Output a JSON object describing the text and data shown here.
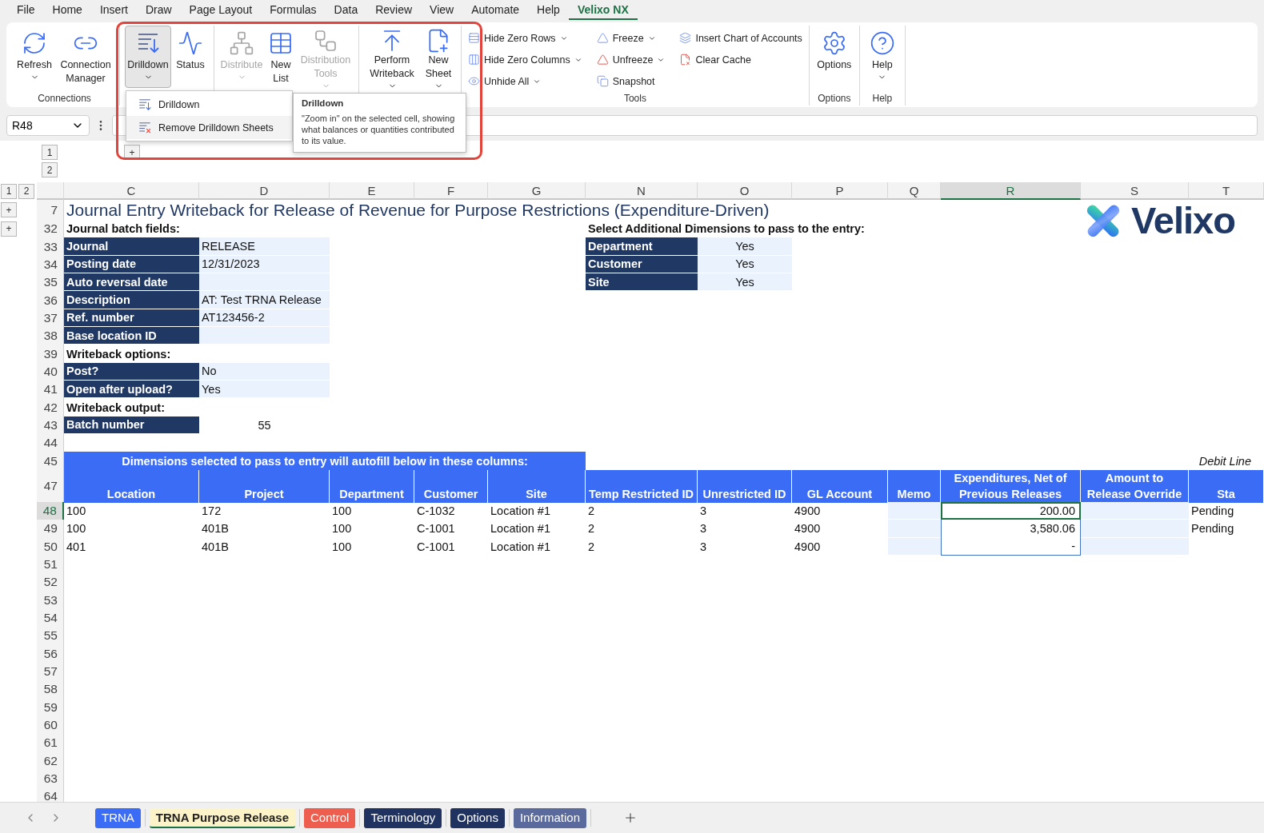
{
  "menu_tabs": [
    {
      "label": "File",
      "selected": false
    },
    {
      "label": "Home",
      "selected": false
    },
    {
      "label": "Insert",
      "selected": false
    },
    {
      "label": "Draw",
      "selected": false
    },
    {
      "label": "Page Layout",
      "selected": false
    },
    {
      "label": "Formulas",
      "selected": false
    },
    {
      "label": "Data",
      "selected": false
    },
    {
      "label": "Review",
      "selected": false
    },
    {
      "label": "View",
      "selected": false
    },
    {
      "label": "Automate",
      "selected": false
    },
    {
      "label": "Help",
      "selected": false
    },
    {
      "label": "Velixo NX",
      "selected": true
    }
  ],
  "ribbon": {
    "connections": {
      "label": "Connections",
      "buttons": [
        {
          "label": "Refresh",
          "caret": true,
          "disabled": false,
          "pressed": false
        },
        {
          "label": "Connection Manager",
          "caret": false,
          "disabled": false,
          "pressed": false
        }
      ]
    },
    "main": {
      "buttons": [
        {
          "label": "Drilldown",
          "caret": true,
          "disabled": false,
          "pressed": true
        },
        {
          "label": "Status",
          "caret": false,
          "disabled": false,
          "pressed": false
        },
        {
          "label": "Distribute",
          "caret": true,
          "disabled": true,
          "pressed": false
        },
        {
          "label": "New List",
          "caret": false,
          "disabled": false,
          "pressed": false
        },
        {
          "label": "Distribution Tools",
          "caret": true,
          "disabled": true,
          "pressed": false
        },
        {
          "label": "Perform Writeback",
          "caret": true,
          "disabled": false,
          "pressed": false
        },
        {
          "label": "New Sheet",
          "caret": true,
          "disabled": false,
          "pressed": false
        }
      ]
    },
    "tools": {
      "label": "Tools",
      "buttons": [
        {
          "label": "Hide Zero Rows",
          "caret": true
        },
        {
          "label": "Hide Zero Columns",
          "caret": true
        },
        {
          "label": "Unhide All",
          "caret": true
        },
        {
          "label": "Freeze",
          "caret": true
        },
        {
          "label": "Unfreeze",
          "caret": true
        },
        {
          "label": "Snapshot",
          "caret": false
        },
        {
          "label": "Insert Chart of Accounts",
          "caret": false
        },
        {
          "label": "Clear Cache",
          "caret": false
        }
      ]
    },
    "options": {
      "label": "Options",
      "buttons": [
        {
          "label": "Options",
          "caret": false,
          "disabled": false,
          "pressed": false
        }
      ]
    },
    "help": {
      "label": "Help",
      "buttons": [
        {
          "label": "Help",
          "caret": true,
          "disabled": false,
          "pressed": false
        }
      ]
    }
  },
  "dropdown_menu": {
    "items": [
      {
        "label": "Drilldown",
        "selected": false
      },
      {
        "label": "Remove Drilldown Sheets",
        "selected": true
      }
    ]
  },
  "tooltip": {
    "title": "Drilldown",
    "text": "\"Zoom in\" on the selected cell, showing what balances or quantities contributed to its value."
  },
  "name_box": "R48",
  "outline": {
    "column_levels": [
      "1",
      "2"
    ],
    "column_expand": "+",
    "row_levels": [
      "1",
      "2"
    ]
  },
  "columns": [
    {
      "letter": "C",
      "selected": false
    },
    {
      "letter": "D",
      "selected": false
    },
    {
      "letter": "E",
      "selected": false
    },
    {
      "letter": "F",
      "selected": false
    },
    {
      "letter": "G",
      "selected": false
    },
    {
      "letter": "N",
      "selected": false
    },
    {
      "letter": "O",
      "selected": false
    },
    {
      "letter": "P",
      "selected": false
    },
    {
      "letter": "Q",
      "selected": false
    },
    {
      "letter": "R",
      "selected": true
    },
    {
      "letter": "S",
      "selected": false
    },
    {
      "letter": "T",
      "selected": false
    }
  ],
  "row_headers": [
    {
      "number": "7",
      "selected": false,
      "expand": "+"
    },
    {
      "number": "32",
      "selected": false,
      "expand": "+"
    },
    {
      "number": "33",
      "selected": false
    },
    {
      "number": "34",
      "selected": false
    },
    {
      "number": "35",
      "selected": false
    },
    {
      "number": "36",
      "selected": false
    },
    {
      "number": "37",
      "selected": false
    },
    {
      "number": "38",
      "selected": false
    },
    {
      "number": "39",
      "selected": false
    },
    {
      "number": "40",
      "selected": false
    },
    {
      "number": "41",
      "selected": false
    },
    {
      "number": "42",
      "selected": false
    },
    {
      "number": "43",
      "selected": false
    },
    {
      "number": "44",
      "selected": false
    },
    {
      "number": "45",
      "selected": false
    },
    {
      "number": "47",
      "selected": false
    },
    {
      "number": "48",
      "selected": true
    },
    {
      "number": "49",
      "selected": false
    },
    {
      "number": "50",
      "selected": false
    },
    {
      "number": "51",
      "selected": false
    },
    {
      "number": "52",
      "selected": false
    },
    {
      "number": "53",
      "selected": false
    },
    {
      "number": "54",
      "selected": false
    },
    {
      "number": "55",
      "selected": false
    },
    {
      "number": "56",
      "selected": false
    },
    {
      "number": "57",
      "selected": false
    },
    {
      "number": "58",
      "selected": false
    },
    {
      "number": "59",
      "selected": false
    },
    {
      "number": "60",
      "selected": false
    },
    {
      "number": "61",
      "selected": false
    },
    {
      "number": "62",
      "selected": false
    },
    {
      "number": "63",
      "selected": false
    },
    {
      "number": "64",
      "selected": false
    }
  ],
  "logo": {
    "text": "Velixo"
  },
  "sheet_title": "Journal Entry Writeback for Release of Revenue for Purpose Restrictions (Expenditure-Driven)",
  "batch_fields": {
    "heading": "Journal batch fields:",
    "fields": [
      {
        "label": "Journal",
        "value": "RELEASE"
      },
      {
        "label": "Posting date",
        "value": "12/31/2023"
      },
      {
        "label": "Auto reversal date"
      },
      {
        "label": "Description",
        "value": "AT: Test TRNA Release"
      },
      {
        "label": "Ref. number",
        "value": "AT123456-2"
      },
      {
        "label": "Base location ID"
      }
    ]
  },
  "dimensions": {
    "heading": "Select Additional Dimensions to pass to the entry:",
    "items": [
      {
        "label": "Department",
        "value": "Yes"
      },
      {
        "label": "Customer",
        "value": "Yes"
      },
      {
        "label": "Site",
        "value": "Yes"
      }
    ]
  },
  "writeback_options": {
    "heading": "Writeback options:",
    "fields": [
      {
        "label": "Post?",
        "value": "No"
      },
      {
        "label": "Open after upload?",
        "value": "Yes"
      }
    ]
  },
  "writeback_output": {
    "heading": "Writeback output:",
    "fields": [
      {
        "label": "Batch number",
        "value": "55"
      }
    ]
  },
  "lines": {
    "banner": "Dimensions selected to pass to entry will autofill below in these columns:",
    "note": "Debit Line",
    "columns": [
      "Location",
      "Project",
      "Department",
      "Customer",
      "Site",
      "Temp Restricted ID",
      "Unrestricted ID",
      "GL Account",
      "Memo",
      "Expenditures, Net of Previous Releases",
      "Amount to Release Override",
      "Sta"
    ],
    "rows": [
      {
        "location": "100",
        "project": "172",
        "department": "100",
        "customer": "C-1032",
        "site": "Location #1",
        "temp_restricted_id": "2",
        "unrestricted_id": "3",
        "gl_account": "4900",
        "expenditures": "200.00",
        "status": "Pending"
      },
      {
        "location": "100",
        "project": "401B",
        "department": "100",
        "customer": "C-1001",
        "site": "Location #1",
        "temp_restricted_id": "2",
        "unrestricted_id": "3",
        "gl_account": "4900",
        "expenditures": "3,580.06",
        "status": "Pending"
      },
      {
        "location": "401",
        "project": "401B",
        "department": "100",
        "customer": "C-1001",
        "site": "Location #1",
        "temp_restricted_id": "2",
        "unrestricted_id": "3",
        "gl_account": "4900",
        "expenditures": "-"
      }
    ]
  },
  "sheet_tabs": [
    {
      "label": "TRNA",
      "selected": false,
      "color": "#3b6cf6"
    },
    {
      "label": "TRNA Purpose Release",
      "selected": true,
      "color": "#fdf3c8"
    },
    {
      "label": "Control",
      "selected": false,
      "color": "#ee5e4f"
    },
    {
      "label": "Terminology",
      "selected": false,
      "color": "#203360"
    },
    {
      "label": "Options",
      "selected": false,
      "color": "#203360"
    },
    {
      "label": "Information",
      "selected": false,
      "color": "#5a6a9c"
    }
  ]
}
